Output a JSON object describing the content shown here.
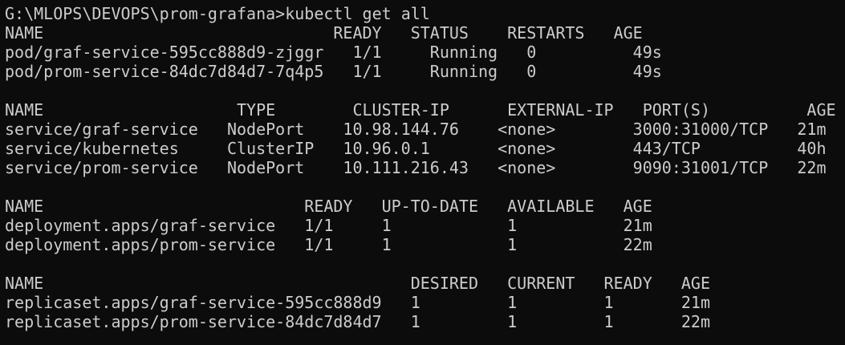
{
  "terminal": {
    "prompt": "G:\\MLOPS\\DEVOPS\\prom-grafana>",
    "command": "kubectl get all",
    "colors": {
      "background": "#0c0c0c",
      "foreground": "#cccccc"
    },
    "pods": {
      "header": "NAME                              READY   STATUS    RESTARTS   AGE",
      "rows": [
        "pod/graf-service-595cc888d9-zjggr   1/1     Running   0          49s",
        "pod/prom-service-84dc7d84d7-7q4p5   1/1     Running   0          49s"
      ]
    },
    "services": {
      "header": "NAME                    TYPE        CLUSTER-IP      EXTERNAL-IP   PORT(S)          AGE",
      "rows": [
        "service/graf-service   NodePort    10.98.144.76    <none>        3000:31000/TCP   21m",
        "service/kubernetes     ClusterIP   10.96.0.1       <none>        443/TCP          40h",
        "service/prom-service   NodePort    10.111.216.43   <none>        9090:31001/TCP   22m"
      ]
    },
    "deployments": {
      "header": "NAME                           READY   UP-TO-DATE   AVAILABLE   AGE",
      "rows": [
        "deployment.apps/graf-service   1/1     1            1           21m",
        "deployment.apps/prom-service   1/1     1            1           22m"
      ]
    },
    "replicasets": {
      "header": "NAME                                      DESIRED   CURRENT   READY   AGE",
      "rows": [
        "replicaset.apps/graf-service-595cc888d9   1         1         1       21m",
        "replicaset.apps/prom-service-84dc7d84d7   1         1         1       22m"
      ]
    }
  }
}
